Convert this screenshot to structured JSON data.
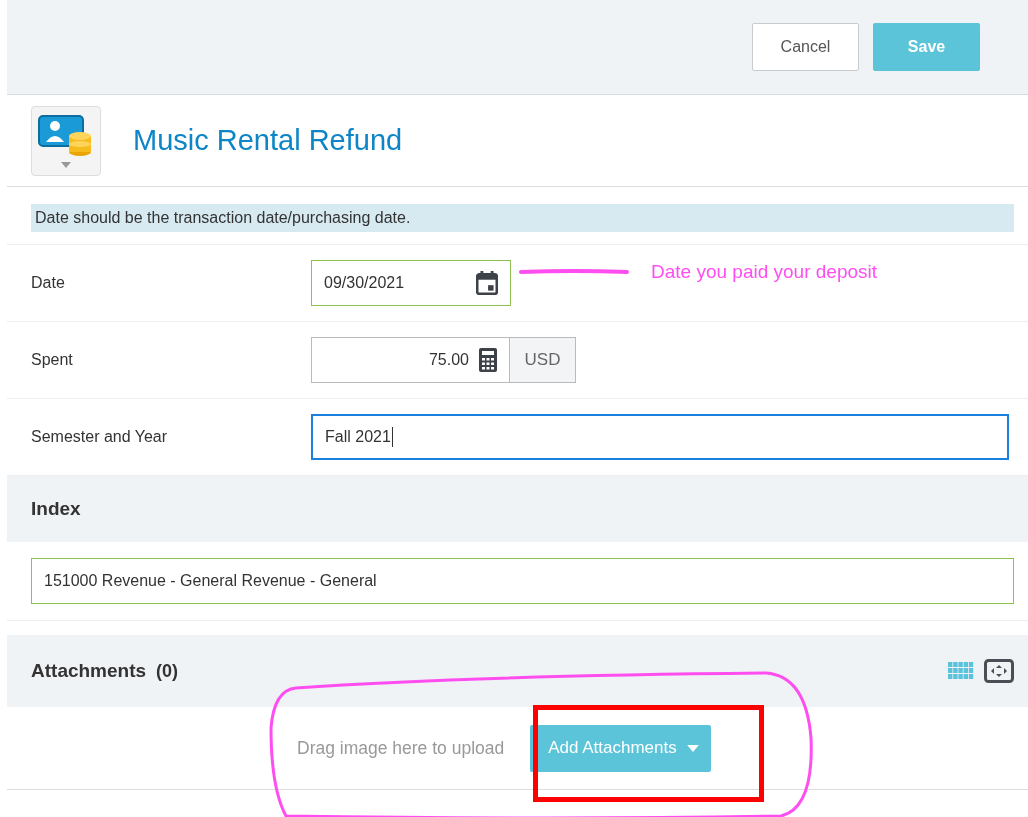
{
  "toolbar": {
    "buttons": [
      {
        "label": "Cancel",
        "kind": "secondary"
      },
      {
        "label": "Save",
        "kind": "primary"
      }
    ]
  },
  "header": {
    "title": "Music Rental Refund"
  },
  "notice": "Date should be the transaction date/purchasing date.",
  "fields": [
    {
      "label": "Date",
      "kind": "date",
      "value": "09/30/2021",
      "valid": true,
      "focused": false,
      "annotation": "Date you paid your deposit"
    },
    {
      "label": "Spent",
      "kind": "currency",
      "value": "75.00",
      "currency": "USD",
      "valid": false,
      "focused": false
    },
    {
      "label": "Semester and Year",
      "kind": "text",
      "value": "Fall 2021",
      "focused": true
    }
  ],
  "index": {
    "title": "Index",
    "value": "151000 Revenue - General Revenue - General",
    "valid": true
  },
  "attachments": {
    "title": "Attachments",
    "count": "(0)",
    "drop_hint": "Drag image here to upload",
    "button": "Add Attachments"
  }
}
